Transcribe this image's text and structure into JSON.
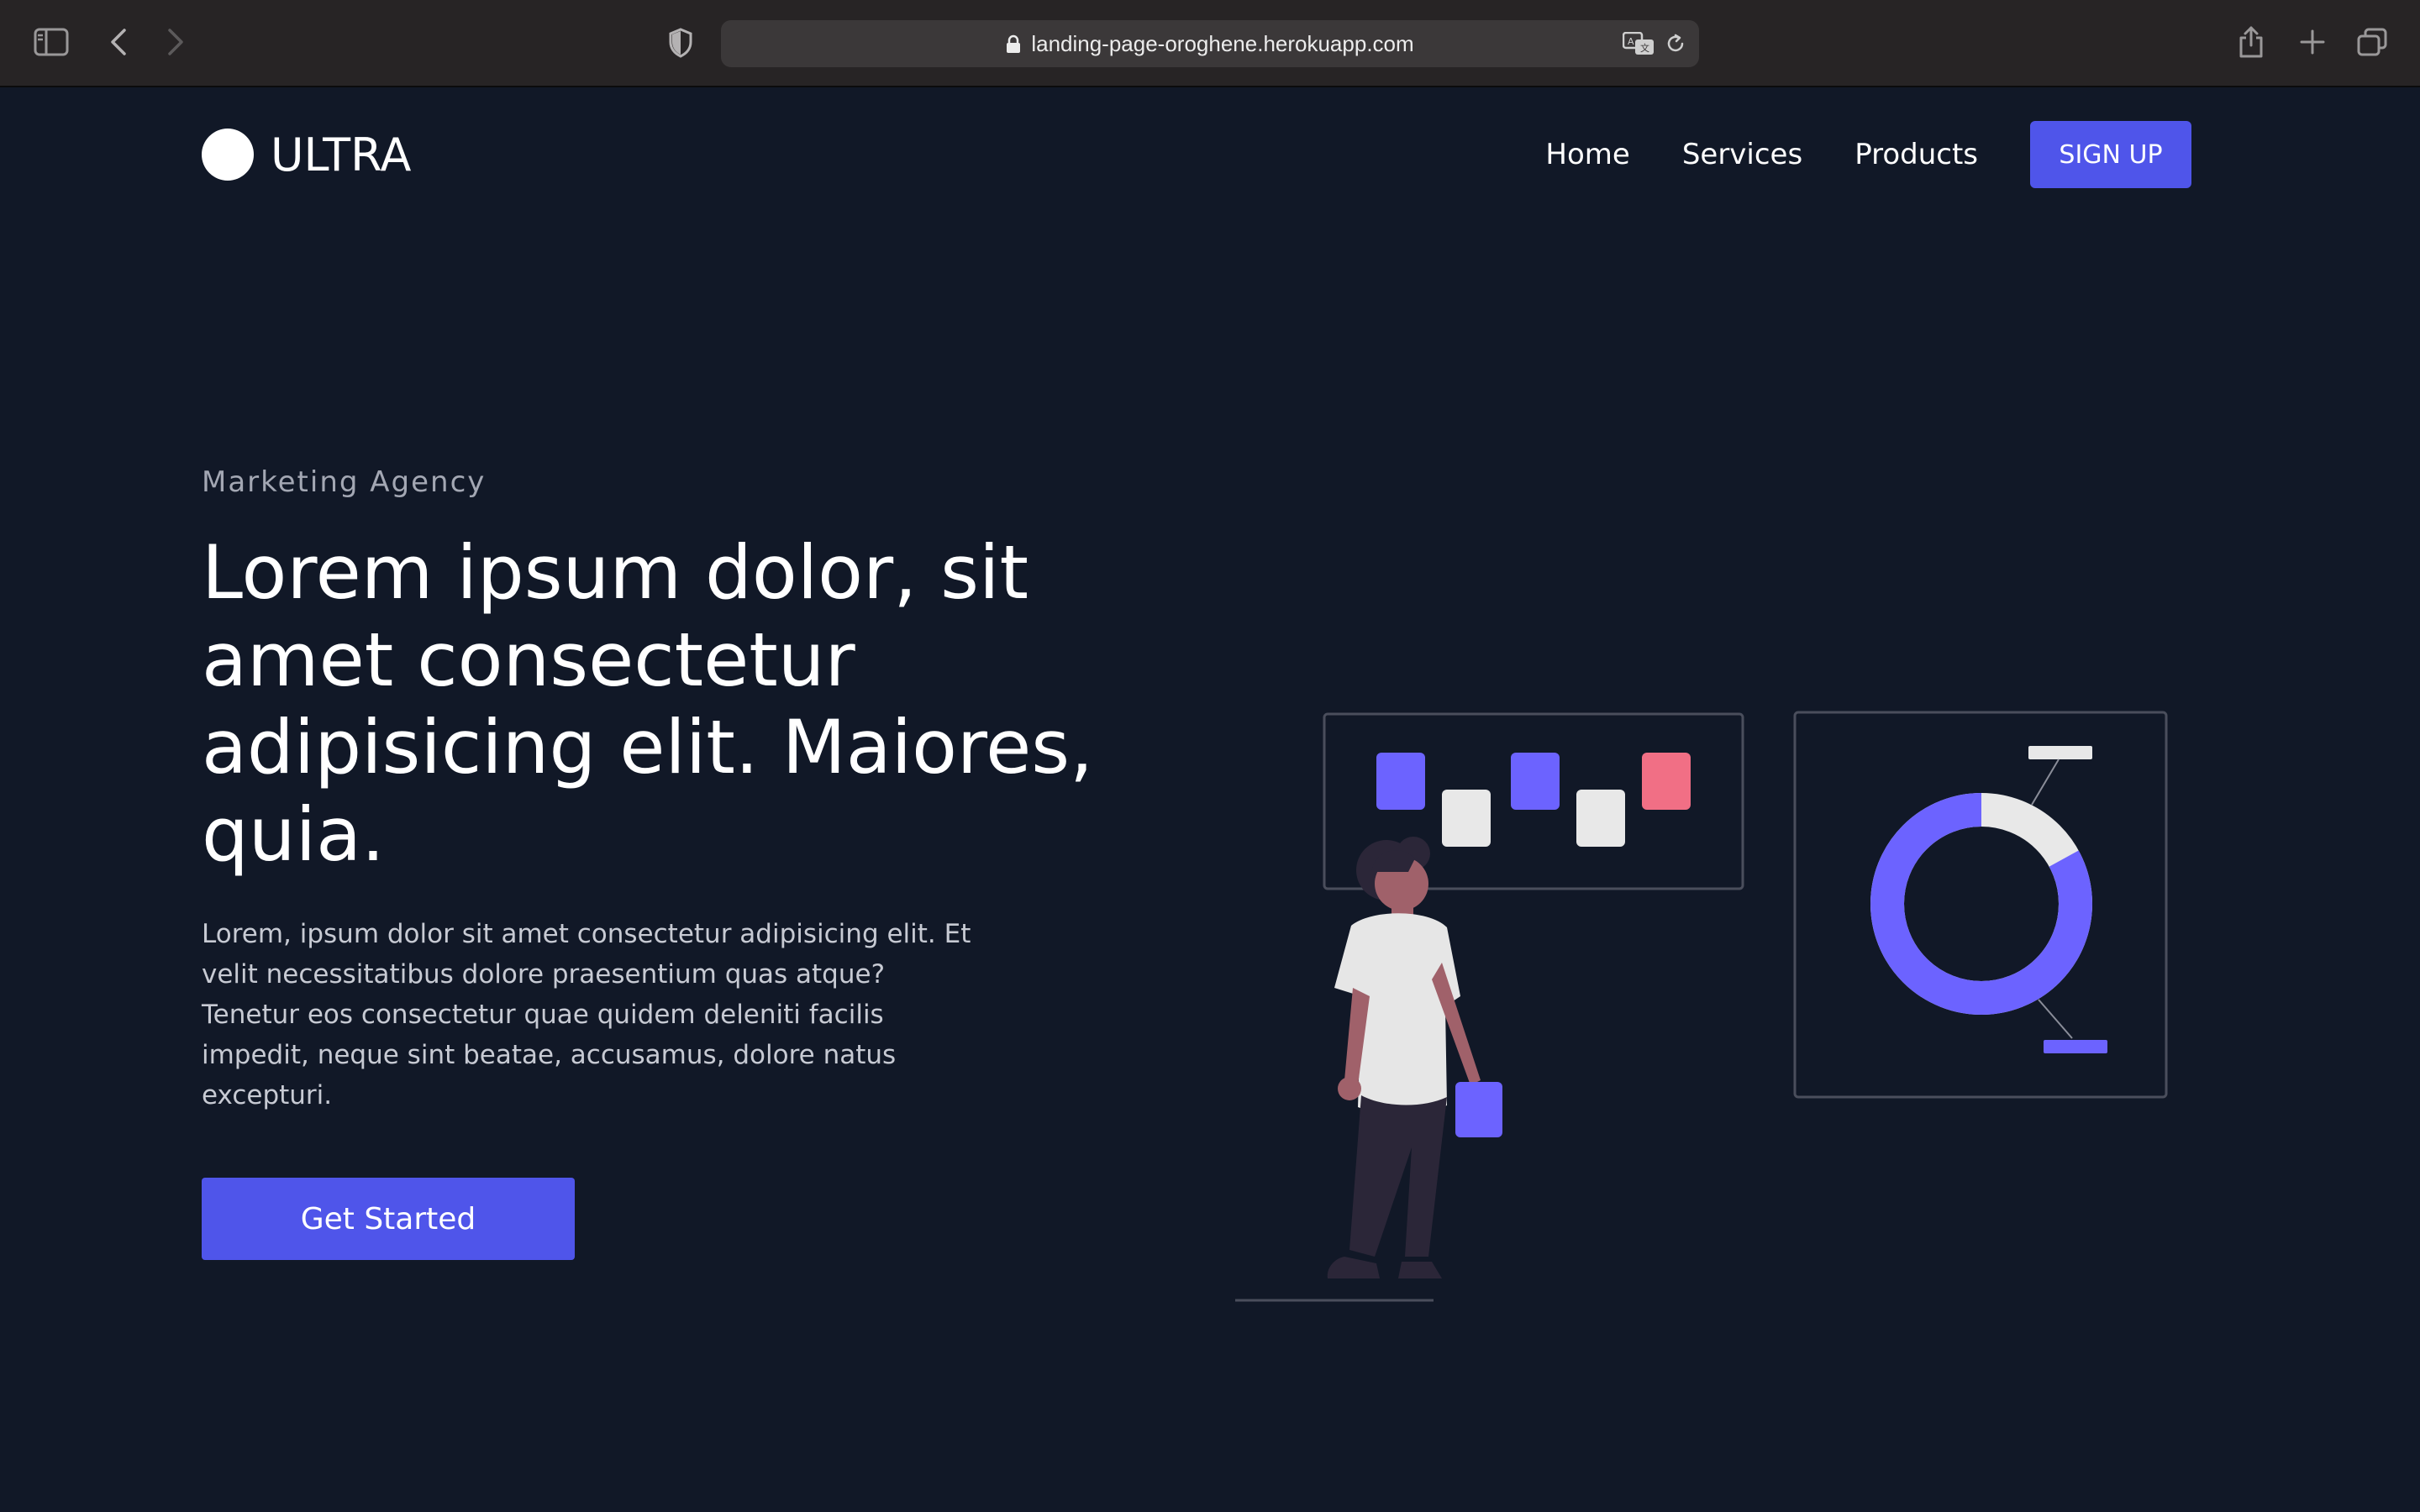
{
  "browser": {
    "url": "landing-page-oroghene.herokuapp.com"
  },
  "brand": {
    "name": "ULTRA"
  },
  "nav": {
    "items": [
      {
        "label": "Home"
      },
      {
        "label": "Services"
      },
      {
        "label": "Products"
      }
    ],
    "signup_label": "SIGN UP"
  },
  "hero": {
    "eyebrow": "Marketing Agency",
    "title": "Lorem ipsum dolor, sit amet consectetur adipisicing elit. Maiores, quia.",
    "body": "Lorem, ipsum dolor sit amet consectetur adipisicing elit. Et velit necessitatibus dolore praesentium quas atque? Tenetur eos consectetur quae quidem deleniti facilis impedit, neque sint beatae, accusamus, dolore natus excepturi.",
    "cta_label": "Get Started"
  },
  "icons": {
    "sidebar": "sidebar-icon",
    "back": "chevron-left-icon",
    "forward": "chevron-right-icon",
    "privacy": "shield-icon",
    "lock": "lock-icon",
    "translate": "translate-icon",
    "reload": "reload-icon",
    "share": "share-icon",
    "new_tab": "plus-icon",
    "tab_overview": "tabs-icon"
  },
  "colors": {
    "background": "#111827",
    "accent": "#4f55ea",
    "illustration_accent": "#6c63ff",
    "illustration_pink": "#f16f85",
    "illustration_light": "#e8e8e8"
  },
  "illustration": {
    "donut_accent_fraction": 0.83
  }
}
